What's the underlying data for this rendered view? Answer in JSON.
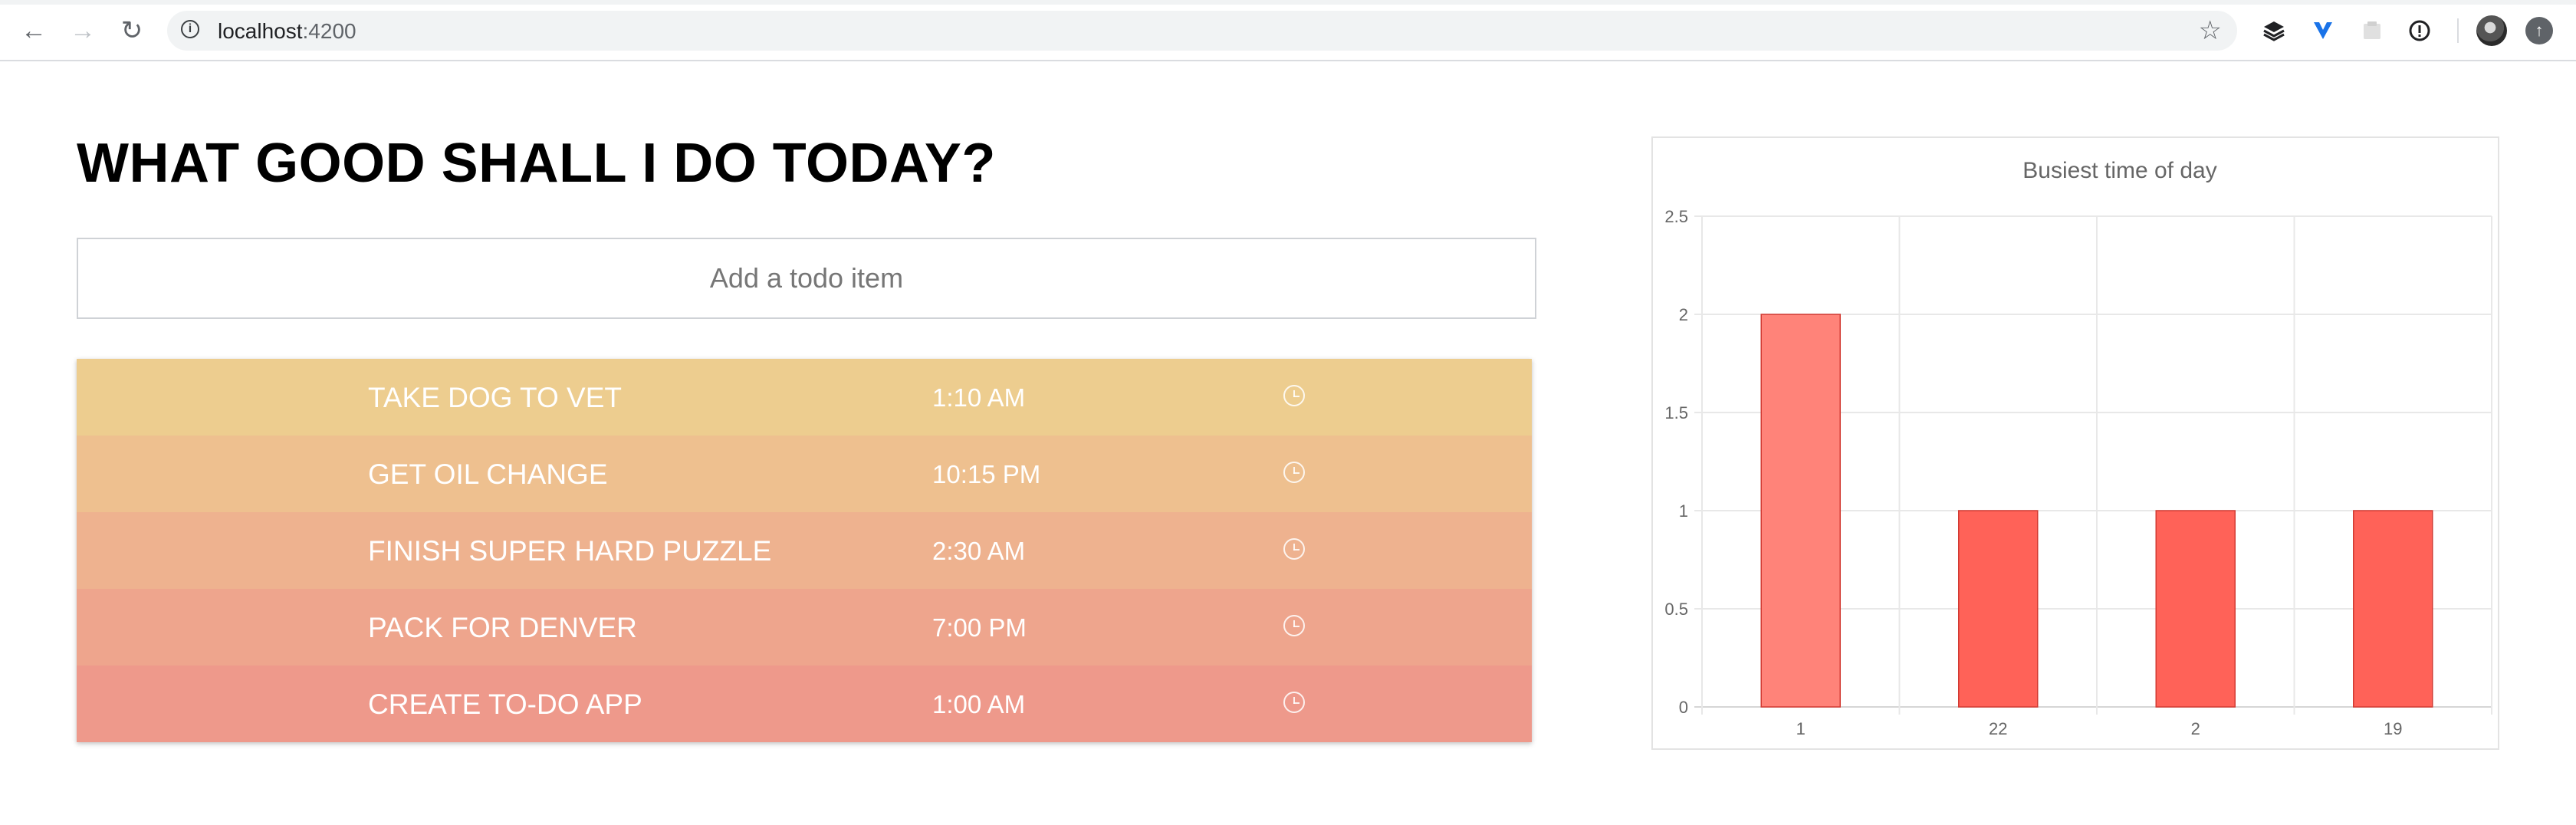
{
  "browser": {
    "back_icon": "arrow-left-icon",
    "forward_icon": "arrow-right-icon",
    "reload_icon": "reload-icon",
    "url_host": "localhost",
    "url_port": ":4200",
    "bookmark_icon": "star-icon",
    "extensions": [
      "layers-icon",
      "v-extension-icon",
      "puzzle-extension-icon",
      "info-extension-icon"
    ]
  },
  "page": {
    "title": "WHAT GOOD SHALL I DO TODAY?",
    "input_placeholder": "Add a todo item",
    "input_value": ""
  },
  "todos": [
    {
      "title": "TAKE DOG TO VET",
      "time": "1:10 AM",
      "color": "#EDCD8F"
    },
    {
      "title": "GET OIL CHANGE",
      "time": "10:15 PM",
      "color": "#EEC08F"
    },
    {
      "title": "FINISH SUPER HARD PUZZLE",
      "time": "2:30 AM",
      "color": "#EEB28F"
    },
    {
      "title": "PACK FOR DENVER",
      "time": "7:00 PM",
      "color": "#EEA58D"
    },
    {
      "title": "CREATE TO-DO APP",
      "time": "1:00 AM",
      "color": "#EE998B"
    }
  ],
  "chart_data": {
    "type": "bar",
    "title": "Busiest time of day",
    "categories": [
      "1",
      "22",
      "2",
      "19"
    ],
    "values": [
      2,
      1,
      1,
      1
    ],
    "ylim": [
      0,
      2.5
    ],
    "yticks": [
      "0",
      "0.5",
      "1",
      "1.5",
      "2",
      "2.5"
    ],
    "grid": true,
    "bar_colors": [
      "#FF8379",
      "#FF6258",
      "#FF6258",
      "#FF6258"
    ],
    "bar_border": "#D23A32"
  }
}
